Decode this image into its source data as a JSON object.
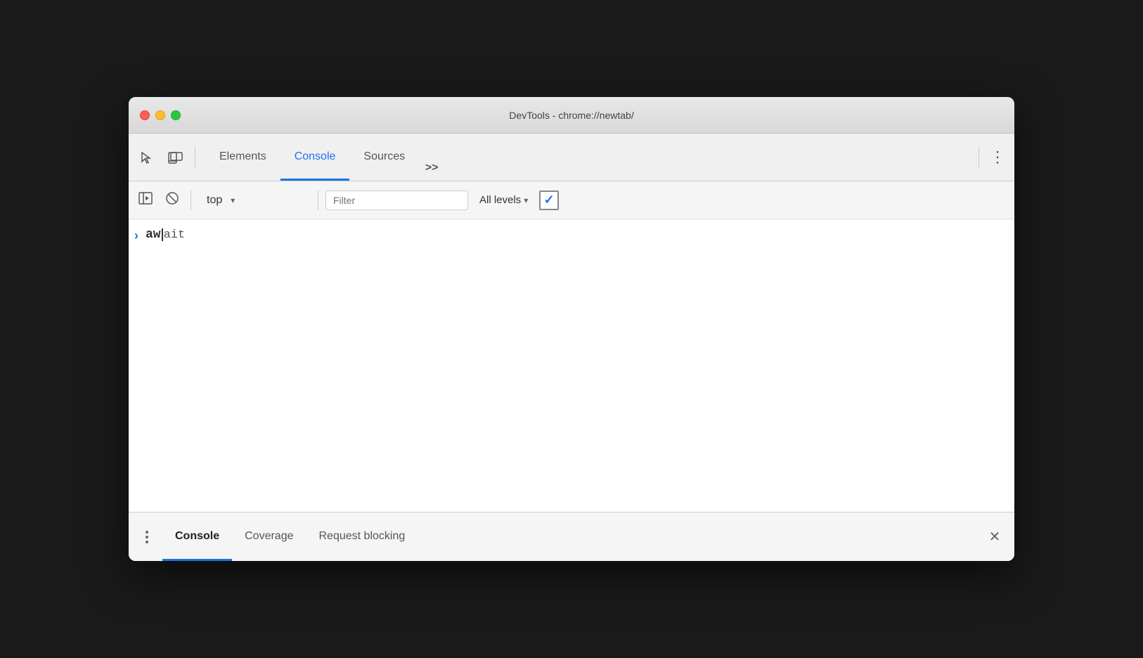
{
  "window": {
    "title": "DevTools - chrome://newtab/"
  },
  "traffic_lights": {
    "close_label": "close",
    "minimize_label": "minimize",
    "maximize_label": "maximize"
  },
  "top_toolbar": {
    "inspect_icon": "inspect-cursor",
    "device_icon": "device-mode",
    "tabs": [
      {
        "id": "elements",
        "label": "Elements",
        "active": false
      },
      {
        "id": "console",
        "label": "Console",
        "active": true
      },
      {
        "id": "sources",
        "label": "Sources",
        "active": false
      }
    ],
    "more_label": ">>",
    "menu_label": "⋮"
  },
  "console_toolbar": {
    "clear_icon": "clear-console",
    "block_icon": "block-errors",
    "context_label": "top",
    "context_dropdown": "▾",
    "filter_placeholder": "Filter",
    "levels_label": "All levels",
    "levels_dropdown": "▾",
    "checkbox_checked": true
  },
  "console_entry": {
    "expand_arrow": "›",
    "text_bold": "aw",
    "text_mono": "ait"
  },
  "bottom_drawer": {
    "three_dots": "⋮",
    "tabs": [
      {
        "id": "console",
        "label": "Console",
        "active": true
      },
      {
        "id": "coverage",
        "label": "Coverage",
        "active": false
      },
      {
        "id": "request-blocking",
        "label": "Request blocking",
        "active": false
      }
    ],
    "close_label": "✕"
  },
  "colors": {
    "active_tab_underline": "#1a73e8",
    "expand_arrow": "#1a73e8",
    "close_btn_text": "#555"
  }
}
